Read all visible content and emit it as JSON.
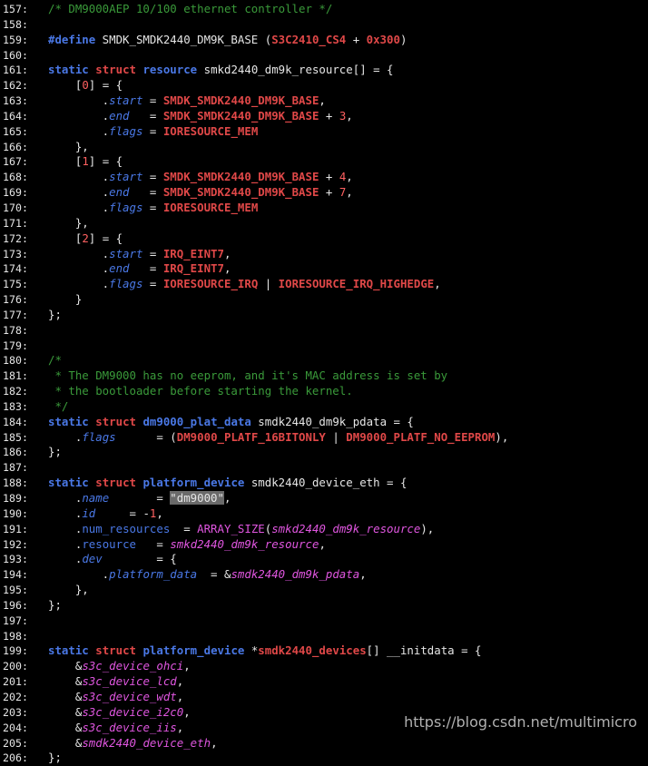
{
  "colors": {
    "background": "#000000",
    "line_number": "#e6e6e6",
    "comment": "#3a9a3a",
    "keyword": "#4a78e6",
    "type_keyword": "#e04848",
    "string_highlight_bg": "#6a6a6a",
    "identifier_magenta": "#e056e0"
  },
  "watermark": "https://blog.csdn.net/multimicro",
  "lines": [
    {
      "n": "157:",
      "t": [
        [
          "comment",
          "/* DM9000AEP 10/100 ethernet controller */"
        ]
      ]
    },
    {
      "n": "158:",
      "t": []
    },
    {
      "n": "159:",
      "t": [
        [
          "pp",
          "#define"
        ],
        [
          "plain",
          " SMDK_SMDK2440_DM9K_BASE ("
        ],
        [
          "const",
          "S3C2410_CS4"
        ],
        [
          "plain",
          " + "
        ],
        [
          "const",
          "0x300"
        ],
        [
          "plain",
          ")"
        ]
      ]
    },
    {
      "n": "160:",
      "t": []
    },
    {
      "n": "161:",
      "t": [
        [
          "kw",
          "static"
        ],
        [
          "plain",
          " "
        ],
        [
          "type",
          "struct"
        ],
        [
          "plain",
          " "
        ],
        [
          "kw",
          "resource"
        ],
        [
          "plain",
          " smkd2440_dm9k_resource[] = {"
        ]
      ]
    },
    {
      "n": "162:",
      "t": [
        [
          "plain",
          "    ["
        ],
        [
          "num",
          "0"
        ],
        [
          "plain",
          "] = {"
        ]
      ]
    },
    {
      "n": "163:",
      "t": [
        [
          "plain",
          "        ."
        ],
        [
          "field",
          "start"
        ],
        [
          "plain",
          " = "
        ],
        [
          "const",
          "SMDK_SMDK2440_DM9K_BASE"
        ],
        [
          "plain",
          ","
        ]
      ]
    },
    {
      "n": "164:",
      "t": [
        [
          "plain",
          "        ."
        ],
        [
          "field",
          "end"
        ],
        [
          "plain",
          "   = "
        ],
        [
          "const",
          "SMDK_SMDK2440_DM9K_BASE"
        ],
        [
          "plain",
          " + "
        ],
        [
          "num",
          "3"
        ],
        [
          "plain",
          ","
        ]
      ]
    },
    {
      "n": "165:",
      "t": [
        [
          "plain",
          "        ."
        ],
        [
          "field",
          "flags"
        ],
        [
          "plain",
          " = "
        ],
        [
          "const",
          "IORESOURCE_MEM"
        ]
      ]
    },
    {
      "n": "166:",
      "t": [
        [
          "plain",
          "    },"
        ]
      ]
    },
    {
      "n": "167:",
      "t": [
        [
          "plain",
          "    ["
        ],
        [
          "num",
          "1"
        ],
        [
          "plain",
          "] = {"
        ]
      ]
    },
    {
      "n": "168:",
      "t": [
        [
          "plain",
          "        ."
        ],
        [
          "field",
          "start"
        ],
        [
          "plain",
          " = "
        ],
        [
          "const",
          "SMDK_SMDK2440_DM9K_BASE"
        ],
        [
          "plain",
          " + "
        ],
        [
          "num",
          "4"
        ],
        [
          "plain",
          ","
        ]
      ]
    },
    {
      "n": "169:",
      "t": [
        [
          "plain",
          "        ."
        ],
        [
          "field",
          "end"
        ],
        [
          "plain",
          "   = "
        ],
        [
          "const",
          "SMDK_SMDK2440_DM9K_BASE"
        ],
        [
          "plain",
          " + "
        ],
        [
          "num",
          "7"
        ],
        [
          "plain",
          ","
        ]
      ]
    },
    {
      "n": "170:",
      "t": [
        [
          "plain",
          "        ."
        ],
        [
          "field",
          "flags"
        ],
        [
          "plain",
          " = "
        ],
        [
          "const",
          "IORESOURCE_MEM"
        ]
      ]
    },
    {
      "n": "171:",
      "t": [
        [
          "plain",
          "    },"
        ]
      ]
    },
    {
      "n": "172:",
      "t": [
        [
          "plain",
          "    ["
        ],
        [
          "num",
          "2"
        ],
        [
          "plain",
          "] = {"
        ]
      ]
    },
    {
      "n": "173:",
      "t": [
        [
          "plain",
          "        ."
        ],
        [
          "field",
          "start"
        ],
        [
          "plain",
          " = "
        ],
        [
          "const",
          "IRQ_EINT7"
        ],
        [
          "plain",
          ","
        ]
      ]
    },
    {
      "n": "174:",
      "t": [
        [
          "plain",
          "        ."
        ],
        [
          "field",
          "end"
        ],
        [
          "plain",
          "   = "
        ],
        [
          "const",
          "IRQ_EINT7"
        ],
        [
          "plain",
          ","
        ]
      ]
    },
    {
      "n": "175:",
      "t": [
        [
          "plain",
          "        ."
        ],
        [
          "field",
          "flags"
        ],
        [
          "plain",
          " = "
        ],
        [
          "const",
          "IORESOURCE_IRQ"
        ],
        [
          "plain",
          " | "
        ],
        [
          "const",
          "IORESOURCE_IRQ_HIGHEDGE"
        ],
        [
          "plain",
          ","
        ]
      ]
    },
    {
      "n": "176:",
      "t": [
        [
          "plain",
          "    }"
        ]
      ]
    },
    {
      "n": "177:",
      "t": [
        [
          "plain",
          "};"
        ]
      ]
    },
    {
      "n": "178:",
      "t": []
    },
    {
      "n": "179:",
      "t": []
    },
    {
      "n": "180:",
      "t": [
        [
          "comment",
          "/*"
        ]
      ]
    },
    {
      "n": "181:",
      "t": [
        [
          "comment",
          " * The DM9000 has no eeprom, and it's MAC address is set by"
        ]
      ]
    },
    {
      "n": "182:",
      "t": [
        [
          "comment",
          " * the bootloader before starting the kernel."
        ]
      ]
    },
    {
      "n": "183:",
      "t": [
        [
          "comment",
          " */"
        ]
      ]
    },
    {
      "n": "184:",
      "t": [
        [
          "kw",
          "static"
        ],
        [
          "plain",
          " "
        ],
        [
          "type",
          "struct"
        ],
        [
          "plain",
          " "
        ],
        [
          "kw",
          "dm9000_plat_data"
        ],
        [
          "plain",
          " smdk2440_dm9k_pdata = {"
        ]
      ]
    },
    {
      "n": "185:",
      "t": [
        [
          "plain",
          "    ."
        ],
        [
          "field",
          "flags"
        ],
        [
          "plain",
          "      = ("
        ],
        [
          "const",
          "DM9000_PLATF_16BITONLY"
        ],
        [
          "plain",
          " | "
        ],
        [
          "const",
          "DM9000_PLATF_NO_EEPROM"
        ],
        [
          "plain",
          "),"
        ]
      ]
    },
    {
      "n": "186:",
      "t": [
        [
          "plain",
          "};"
        ]
      ]
    },
    {
      "n": "187:",
      "t": []
    },
    {
      "n": "188:",
      "t": [
        [
          "kw",
          "static"
        ],
        [
          "plain",
          " "
        ],
        [
          "type",
          "struct"
        ],
        [
          "plain",
          " "
        ],
        [
          "kw",
          "platform_device"
        ],
        [
          "plain",
          " smdk2440_device_eth = {"
        ]
      ]
    },
    {
      "n": "189:",
      "t": [
        [
          "plain",
          "    ."
        ],
        [
          "field",
          "name"
        ],
        [
          "plain",
          "       = "
        ],
        [
          "string",
          "\"dm9000\""
        ],
        [
          "plain",
          ","
        ]
      ]
    },
    {
      "n": "190:",
      "t": [
        [
          "plain",
          "    ."
        ],
        [
          "field",
          "id"
        ],
        [
          "plain",
          "     = -"
        ],
        [
          "num",
          "1"
        ],
        [
          "plain",
          ","
        ]
      ]
    },
    {
      "n": "191:",
      "t": [
        [
          "plain",
          "    ."
        ],
        [
          "fieldplain",
          "num_resources"
        ],
        [
          "plain",
          "  = "
        ],
        [
          "func",
          "ARRAY_SIZE"
        ],
        [
          "plain",
          "("
        ],
        [
          "var",
          "smkd2440_dm9k_resource"
        ],
        [
          "plain",
          "),"
        ]
      ]
    },
    {
      "n": "192:",
      "t": [
        [
          "plain",
          "    ."
        ],
        [
          "fieldplain",
          "resource"
        ],
        [
          "plain",
          "   = "
        ],
        [
          "var",
          "smkd2440_dm9k_resource"
        ],
        [
          "plain",
          ","
        ]
      ]
    },
    {
      "n": "193:",
      "t": [
        [
          "plain",
          "    ."
        ],
        [
          "field",
          "dev"
        ],
        [
          "plain",
          "        = {"
        ]
      ]
    },
    {
      "n": "194:",
      "t": [
        [
          "plain",
          "        ."
        ],
        [
          "field",
          "platform_data"
        ],
        [
          "plain",
          "  = &"
        ],
        [
          "var",
          "smdk2440_dm9k_pdata"
        ],
        [
          "plain",
          ","
        ]
      ]
    },
    {
      "n": "195:",
      "t": [
        [
          "plain",
          "    },"
        ]
      ]
    },
    {
      "n": "196:",
      "t": [
        [
          "plain",
          "};"
        ]
      ]
    },
    {
      "n": "197:",
      "t": []
    },
    {
      "n": "198:",
      "t": []
    },
    {
      "n": "199:",
      "t": [
        [
          "kw",
          "static"
        ],
        [
          "plain",
          " "
        ],
        [
          "type",
          "struct"
        ],
        [
          "plain",
          " "
        ],
        [
          "kw",
          "platform_device"
        ],
        [
          "plain",
          " *"
        ],
        [
          "type",
          "smdk2440_devices"
        ],
        [
          "plain",
          "[] __initdata = {"
        ]
      ]
    },
    {
      "n": "200:",
      "t": [
        [
          "plain",
          "    &"
        ],
        [
          "var",
          "s3c_device_ohci"
        ],
        [
          "plain",
          ","
        ]
      ]
    },
    {
      "n": "201:",
      "t": [
        [
          "plain",
          "    &"
        ],
        [
          "var",
          "s3c_device_lcd"
        ],
        [
          "plain",
          ","
        ]
      ]
    },
    {
      "n": "202:",
      "t": [
        [
          "plain",
          "    &"
        ],
        [
          "var",
          "s3c_device_wdt"
        ],
        [
          "plain",
          ","
        ]
      ]
    },
    {
      "n": "203:",
      "t": [
        [
          "plain",
          "    &"
        ],
        [
          "var",
          "s3c_device_i2c0"
        ],
        [
          "plain",
          ","
        ]
      ]
    },
    {
      "n": "204:",
      "t": [
        [
          "plain",
          "    &"
        ],
        [
          "var",
          "s3c_device_iis"
        ],
        [
          "plain",
          ","
        ]
      ]
    },
    {
      "n": "205:",
      "t": [
        [
          "plain",
          "    &"
        ],
        [
          "var",
          "smdk2440_device_eth"
        ],
        [
          "plain",
          ","
        ]
      ]
    },
    {
      "n": "206:",
      "t": [
        [
          "plain",
          "};"
        ]
      ]
    }
  ]
}
